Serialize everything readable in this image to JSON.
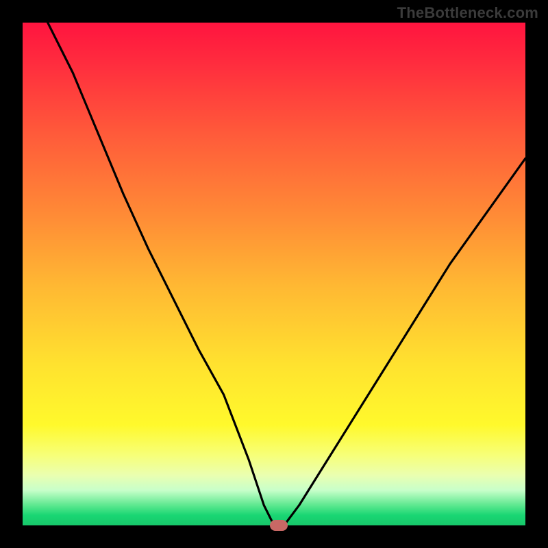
{
  "watermark": "TheBottleneck.com",
  "colors": {
    "frame_bg": "#000000",
    "gradient_top": "#ff143f",
    "gradient_mid1": "#ff8a36",
    "gradient_mid2": "#ffe22f",
    "gradient_bottom": "#17c76a",
    "curve_stroke": "#000000",
    "marker_fill": "#c86865"
  },
  "chart_data": {
    "type": "line",
    "title": "",
    "xlabel": "",
    "ylabel": "",
    "xlim": [
      0,
      100
    ],
    "ylim": [
      0,
      100
    ],
    "series": [
      {
        "name": "bottleneck-curve",
        "x": [
          0,
          5,
          10,
          15,
          20,
          25,
          30,
          35,
          40,
          45,
          48,
          50,
          52,
          55,
          60,
          65,
          70,
          75,
          80,
          85,
          90,
          95,
          100
        ],
        "values": [
          108,
          100,
          90,
          78,
          66,
          55,
          45,
          35,
          26,
          13,
          4,
          0,
          0,
          4,
          12,
          20,
          28,
          36,
          44,
          52,
          59,
          66,
          73
        ]
      }
    ],
    "marker": {
      "x": 51,
      "y": 0
    },
    "legend": false,
    "grid": false
  }
}
